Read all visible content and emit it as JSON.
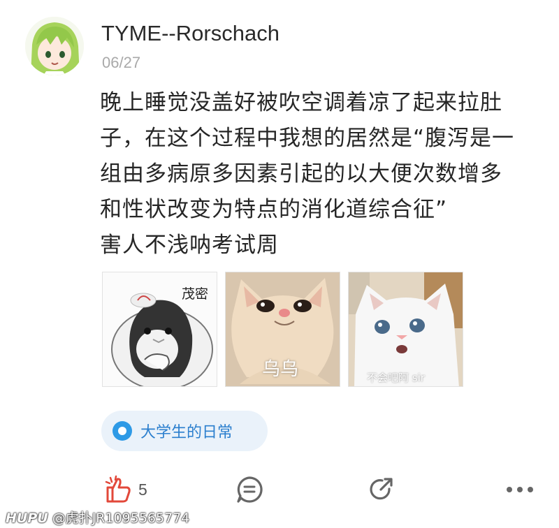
{
  "post": {
    "username": "TYME--Rorschach",
    "date": "06/27",
    "lines": [
      "晚上睡觉没盖好被吹空调着凉了起来拉肚",
      "子，在这个过程中我想的居然是“腹泻是一",
      "组由多病原多因素引起的以大便次数增多",
      "和性状改变为特点的消化道综合征”",
      "害人不浅呐考试周"
    ]
  },
  "images": [
    {
      "caption": "茂密",
      "icon": "penguin-sticker"
    },
    {
      "caption": "乌乌",
      "icon": "crying-cat-sticker"
    },
    {
      "caption": "不会吧阿 sir",
      "icon": "surprised-white-cat-sticker"
    }
  ],
  "topic": {
    "label": "大学生的日常",
    "color": "#2e9ae6"
  },
  "actions": {
    "like_count": "5",
    "accent": "#e2483a"
  },
  "watermark": {
    "brand": "HUPU",
    "handle": "@虎扑JR1095565774"
  }
}
